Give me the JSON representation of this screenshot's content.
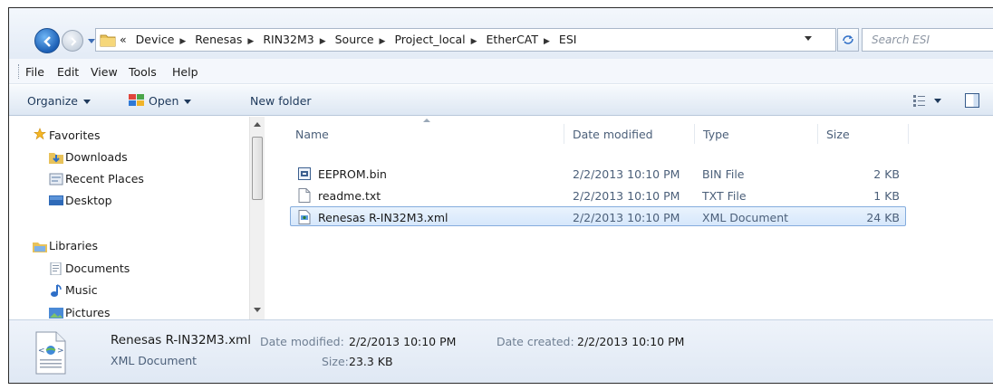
{
  "address": {
    "overflow": "«",
    "crumbs": [
      "Device",
      "Renesas",
      "RIN32M3",
      "Source",
      "Project_local",
      "EtherCAT",
      "ESI"
    ],
    "search_placeholder": "Search ESI"
  },
  "menu": [
    "File",
    "Edit",
    "View",
    "Tools",
    "Help"
  ],
  "command_bar": {
    "organize": "Organize",
    "open": "Open",
    "new_folder": "New folder"
  },
  "nav_pane": {
    "favorites_header": "Favorites",
    "favorites": [
      "Downloads",
      "Recent Places",
      "Desktop"
    ],
    "libraries_header": "Libraries",
    "libraries": [
      "Documents",
      "Music",
      "Pictures"
    ]
  },
  "columns": [
    "Name",
    "Date modified",
    "Type",
    "Size"
  ],
  "files": [
    {
      "name": "EEPROM.bin",
      "date": "2/2/2013 10:10 PM",
      "type": "BIN File",
      "size": "2 KB",
      "icon": "bin-file-icon"
    },
    {
      "name": "readme.txt",
      "date": "2/2/2013 10:10 PM",
      "type": "TXT File",
      "size": "1 KB",
      "icon": "txt-file-icon"
    },
    {
      "name": "Renesas R-IN32M3.xml",
      "date": "2/2/2013 10:10 PM",
      "type": "XML Document",
      "size": "24 KB",
      "icon": "xml-file-icon",
      "selected": true
    }
  ],
  "details": {
    "name": "Renesas R-IN32M3.xml",
    "type": "XML Document",
    "date_modified_label": "Date modified:",
    "date_modified": "2/2/2013 10:10 PM",
    "date_created_label": "Date created:",
    "date_created": "2/2/2013 10:10 PM",
    "size_label": "Size:",
    "size": "23.3 KB"
  },
  "colors": {
    "selection_fill": "#d6e7fb",
    "selection_border": "#84acdd",
    "accent_blue": "#1c5fb5"
  }
}
